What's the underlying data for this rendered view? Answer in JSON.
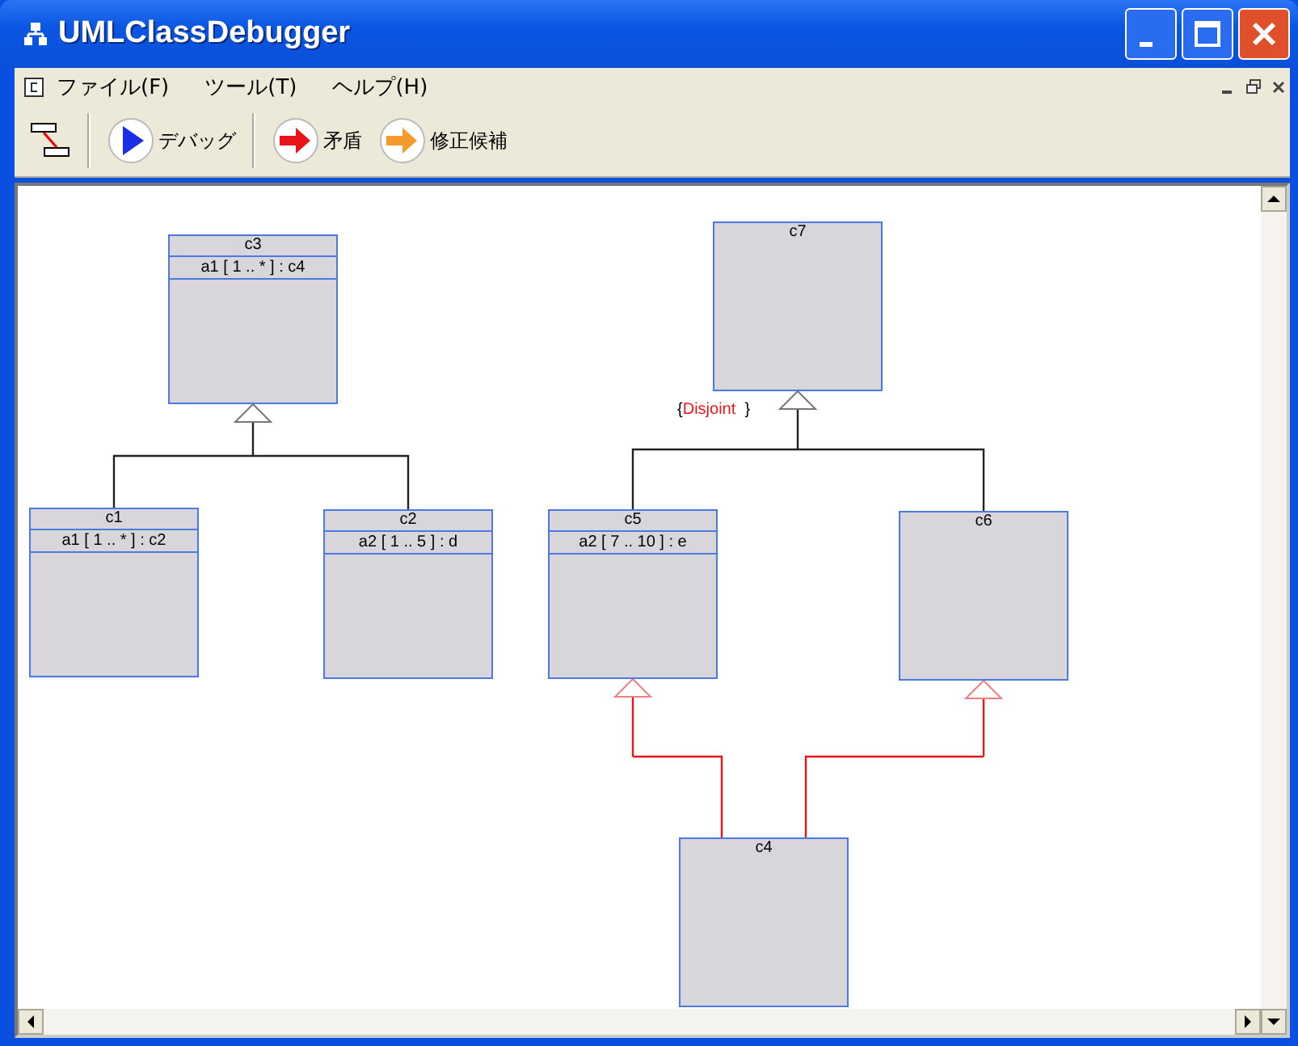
{
  "window": {
    "title": "UMLClassDebugger"
  },
  "menu": {
    "items": [
      {
        "label": "ファイル(F)"
      },
      {
        "label": "ツール(T)"
      },
      {
        "label": "ヘルプ(H)"
      }
    ]
  },
  "toolbar": {
    "buttons": [
      {
        "kind": "layout"
      },
      {
        "kind": "debug",
        "label": "デバッグ"
      },
      {
        "kind": "conflict",
        "label": "矛盾"
      },
      {
        "kind": "fix",
        "label": "修正候補"
      }
    ]
  },
  "diagram": {
    "classes": [
      {
        "name": "c3",
        "attributes": [
          "a1 [ 1 .. * ] : c4"
        ]
      },
      {
        "name": "c1",
        "attributes": [
          "a1 [ 1 .. * ] : c2"
        ]
      },
      {
        "name": "c2",
        "attributes": [
          "a2 [ 1 .. 5 ] : d"
        ]
      },
      {
        "name": "c7"
      },
      {
        "name": "c5",
        "attributes": [
          "a2 [ 7 .. 10 ] : e"
        ]
      },
      {
        "name": "c6"
      },
      {
        "name": "c4"
      }
    ],
    "generalizations": [
      {
        "conflict": false
      },
      {
        "conflict": false,
        "constraint": {
          "open": "{",
          "label": "Disjoint",
          "close": "}"
        }
      },
      {
        "conflict": true
      },
      {
        "conflict": true
      }
    ]
  }
}
